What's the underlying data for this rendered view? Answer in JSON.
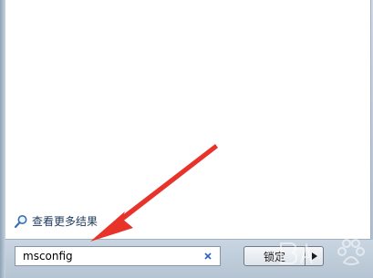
{
  "results": {
    "more_results_label": "查看更多结果",
    "more_results_icon": "search-icon"
  },
  "search": {
    "value": "msconfig",
    "clear_icon": "close-icon"
  },
  "shutdown": {
    "label": "锁定",
    "arrow_icon": "chevron-right-icon"
  },
  "annotation": {
    "color": "#e8332a"
  },
  "watermark": {
    "text": "Baidu经验"
  },
  "colors": {
    "frame": "#b9c7d6",
    "link_text": "#1e395b",
    "clear_icon": "#2a63c4"
  }
}
